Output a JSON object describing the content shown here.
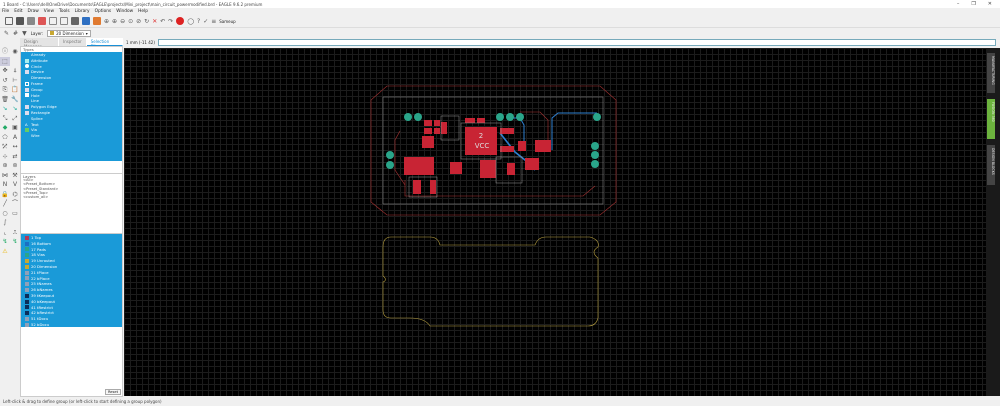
{
  "window": {
    "title": "1 Board - C:\\Users\\dell\\OneDrive\\Documents\\EAGLE\\projects\\Mini_project\\main_circuit_powermodified.brd - EAGLE 9.6.2 premium",
    "minimize": "–",
    "maximize": "❐",
    "close": "✕"
  },
  "menu": [
    "File",
    "Edit",
    "Draw",
    "View",
    "Tools",
    "Library",
    "Options",
    "Window",
    "Help"
  ],
  "toolbar": {
    "sameup_label": "Sameup"
  },
  "layerbar": {
    "label": "Layer:",
    "value": "20 Dimension",
    "color": "#c8a832"
  },
  "tabs": [
    "Design Manager",
    "Inspector",
    "Selection Filter"
  ],
  "selection_filter": {
    "header": "Types",
    "items": [
      "Already",
      "Attribute",
      "Circle",
      "Device",
      "Dimension",
      "Frame",
      "Group",
      "Hole",
      "Line",
      "Polygon Edge",
      "Rectangle",
      "Spline",
      "Text",
      "Via",
      "Wire"
    ]
  },
  "layers_section": {
    "header": "Layers",
    "presets": [
      "<All>",
      "<Preset_Bottom>",
      "<Preset_Standard>",
      "<Preset_Top>",
      "<custom_all>"
    ],
    "layers": [
      {
        "label": "1 Top",
        "color": "#b03a5a"
      },
      {
        "label": "16 Bottom",
        "color": "#1a6fc4"
      },
      {
        "label": "17 Pads",
        "color": "#2aa58a"
      },
      {
        "label": "18 Vias",
        "color": "#2aa58a"
      },
      {
        "label": "19 Unrouted",
        "color": "#c8a832"
      },
      {
        "label": "20 Dimension",
        "color": "#c8a832"
      },
      {
        "label": "21 tPlace",
        "color": "#8fa0b8"
      },
      {
        "label": "22 bPlace",
        "color": "#8fa0b8"
      },
      {
        "label": "25 tNames",
        "color": "#8fa0b8"
      },
      {
        "label": "26 bNames",
        "color": "#8fa0b8"
      },
      {
        "label": "39 tKeepout",
        "color": "#0b2d5a"
      },
      {
        "label": "40 bKeepout",
        "color": "#0b2d5a"
      },
      {
        "label": "41 tRestrict",
        "color": "#0b2d5a"
      },
      {
        "label": "42 bRestrict",
        "color": "#0b2d5a"
      },
      {
        "label": "51 tDocu",
        "color": "#8fa0b8"
      },
      {
        "label": "52 bDocu",
        "color": "#8fa0b8"
      }
    ],
    "reset_label": "Reset"
  },
  "canvas": {
    "coordinate": "1 mm (-11 42)",
    "vcc_label": "VCC",
    "vcc_number": "2"
  },
  "right_panels": [
    "MANUFACTURING",
    "FUSION 360",
    "DESIGN BLOCKS"
  ],
  "status": "Left-click & drag to define group (or left-click to start defining a group polygon)"
}
